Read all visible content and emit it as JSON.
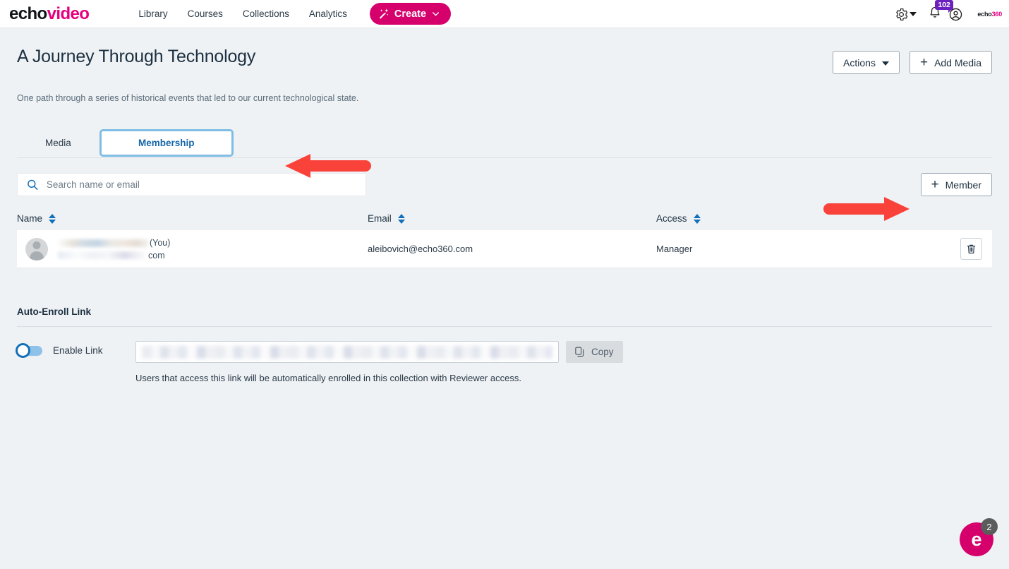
{
  "header": {
    "logo_echo": "echo",
    "logo_video": "video",
    "nav": [
      {
        "label": "Library"
      },
      {
        "label": "Courses"
      },
      {
        "label": "Collections"
      },
      {
        "label": "Analytics"
      }
    ],
    "create_label": "Create",
    "gear_icon": "gear-icon",
    "bell_icon": "bell-icon",
    "notification_count": "102",
    "account_icon": "account-icon",
    "brand_echo": "echo",
    "brand_360": "360"
  },
  "page": {
    "title": "A Journey Through Technology",
    "description": "One path through a series of historical events that led to our current technological state.",
    "actions_label": "Actions",
    "add_media_label": "Add Media"
  },
  "tabs": [
    {
      "label": "Media",
      "active": false
    },
    {
      "label": "Membership",
      "active": true
    }
  ],
  "toolbar": {
    "search_placeholder": "Search name or email",
    "search_value": "",
    "search_icon": "search-icon",
    "member_label": "Member"
  },
  "table": {
    "columns": [
      {
        "label": "Name"
      },
      {
        "label": "Email"
      },
      {
        "label": "Access"
      }
    ],
    "rows": [
      {
        "name_redacted": true,
        "name_suffix": "(You)",
        "name_second_line": "com",
        "email": "aleibovich@echo360.com",
        "access": "Manager",
        "delete_icon": "trash-icon"
      }
    ]
  },
  "auto_enroll": {
    "section_title": "Auto-Enroll Link",
    "toggle_label": "Enable Link",
    "toggle_enabled": false,
    "link_value_redacted": true,
    "copy_label": "Copy",
    "help_text": "Users that access this link will be automatically enrolled in this collection with Reviewer access."
  },
  "chat": {
    "avatar_letter": "e",
    "unread_count": "2"
  },
  "annotations": {
    "arrow_color": "#f9423a",
    "arrow_tabs_direction": "left",
    "arrow_member_direction": "right"
  },
  "colors": {
    "brand_magenta": "#d6006d",
    "accent_blue": "#1270b8",
    "page_bg": "#eef2f5",
    "badge_purple": "#6c20c0"
  }
}
